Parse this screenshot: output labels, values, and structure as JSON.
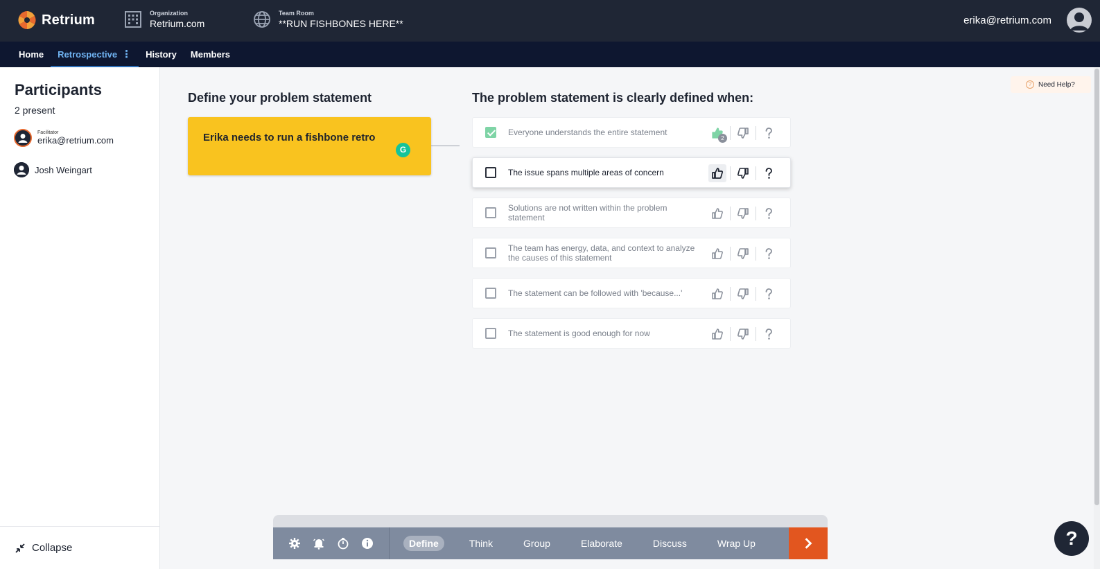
{
  "header": {
    "brand": "Retrium",
    "org_label": "Organization",
    "org_value": "Retrium.com",
    "room_label": "Team Room",
    "room_value": "**RUN FISHBONES HERE**",
    "user_email": "erika@retrium.com"
  },
  "nav": {
    "items": [
      {
        "label": "Home"
      },
      {
        "label": "Retrospective"
      },
      {
        "label": "History"
      },
      {
        "label": "Members"
      }
    ]
  },
  "sidebar": {
    "title": "Participants",
    "count": "2 present",
    "people": [
      {
        "role": "Facilitator",
        "name": "erika@retrium.com"
      },
      {
        "role": "",
        "name": "Josh Weingart"
      }
    ],
    "collapse_label": "Collapse"
  },
  "main": {
    "left_heading": "Define your problem statement",
    "problem_statement": "Erika needs to run a fishbone retro",
    "right_heading": "The problem statement is clearly defined when:",
    "criteria": [
      {
        "text": "Everyone understands the entire statement",
        "checked": true,
        "votes": "2"
      },
      {
        "text": "The issue spans multiple areas of concern",
        "checked": false,
        "votes": ""
      },
      {
        "text": "Solutions are not written within the problem statement",
        "checked": false,
        "votes": ""
      },
      {
        "text": "The team has energy, data, and context to analyze the causes of this statement",
        "checked": false,
        "votes": ""
      },
      {
        "text": "The statement can be followed with 'because...'",
        "checked": false,
        "votes": ""
      },
      {
        "text": "The statement is good enough for now",
        "checked": false,
        "votes": ""
      }
    ],
    "need_help": "Need Help?"
  },
  "toolbar": {
    "phases": [
      "Define",
      "Think",
      "Group",
      "Elaborate",
      "Discuss",
      "Wrap Up"
    ]
  },
  "colors": {
    "accent_orange": "#e2561f",
    "card_yellow": "#f9c31f",
    "nav_active": "#6fb2f0",
    "check_green": "#7fd4a6"
  }
}
